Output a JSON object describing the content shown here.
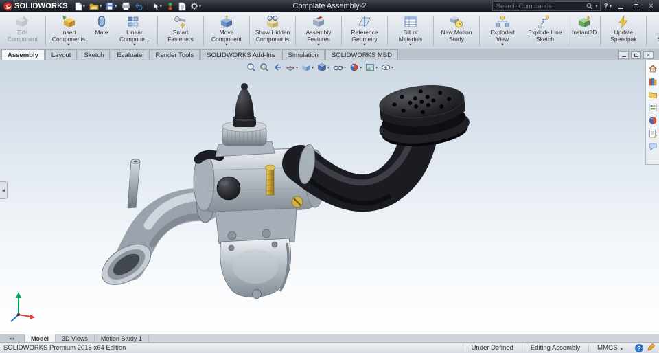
{
  "colors": {
    "titlebar_bg": "#23262d",
    "brand_red": "#cf2e27",
    "ribbon_bg": "#dce2ea",
    "active_tab_bg": "#f4f6f8",
    "viewport_gradient_top": "#ccd7e2",
    "viewport_gradient_bottom": "#ffffff",
    "status_help_blue": "#2f6fc4",
    "triad_green": "#00a651",
    "triad_red": "#e03c31",
    "triad_blue": "#2e6fbd"
  },
  "icons": {
    "dropdown": "▾",
    "close": "×",
    "help": "?",
    "collapse_left": "◀",
    "units_dropdown": "▴",
    "nav_left": "◂",
    "nav_right": "▸"
  },
  "titlebar": {
    "logo_text": "SOLIDWORKS",
    "doc_title": "Complate Assembly-2",
    "search_placeholder": "Search Commands"
  },
  "ribbon": {
    "buttons": [
      {
        "label": "Edit Component"
      },
      {
        "label": "Insert Components"
      },
      {
        "label": "Mate"
      },
      {
        "label": "Linear Compone..."
      },
      {
        "label": "Smart Fasteners"
      },
      {
        "label": "Move Component"
      },
      {
        "label": "Show Hidden Components"
      },
      {
        "label": "Assembly Features"
      },
      {
        "label": "Reference Geometry"
      },
      {
        "label": "Bill of Materials"
      },
      {
        "label": "New Motion Study"
      },
      {
        "label": "Exploded View"
      },
      {
        "label": "Explode Line Sketch"
      },
      {
        "label": "Instant3D"
      },
      {
        "label": "Update Speedpak"
      },
      {
        "label": "Take Snapshot"
      }
    ]
  },
  "command_tabs": {
    "items": [
      {
        "label": "Assembly"
      },
      {
        "label": "Layout"
      },
      {
        "label": "Sketch"
      },
      {
        "label": "Evaluate"
      },
      {
        "label": "Render Tools"
      },
      {
        "label": "SOLIDWORKS Add-Ins"
      },
      {
        "label": "Simulation"
      },
      {
        "label": "SOLIDWORKS MBD"
      }
    ]
  },
  "bottom_tabs": {
    "items": [
      {
        "label": "Model"
      },
      {
        "label": "3D Views"
      },
      {
        "label": "Motion Study 1"
      }
    ]
  },
  "statusbar": {
    "left_text": "SOLIDWORKS Premium 2015 x64 Edition",
    "constraint_status": "Under Defined",
    "mode_status": "Editing Assembly",
    "units": "MMGS"
  }
}
